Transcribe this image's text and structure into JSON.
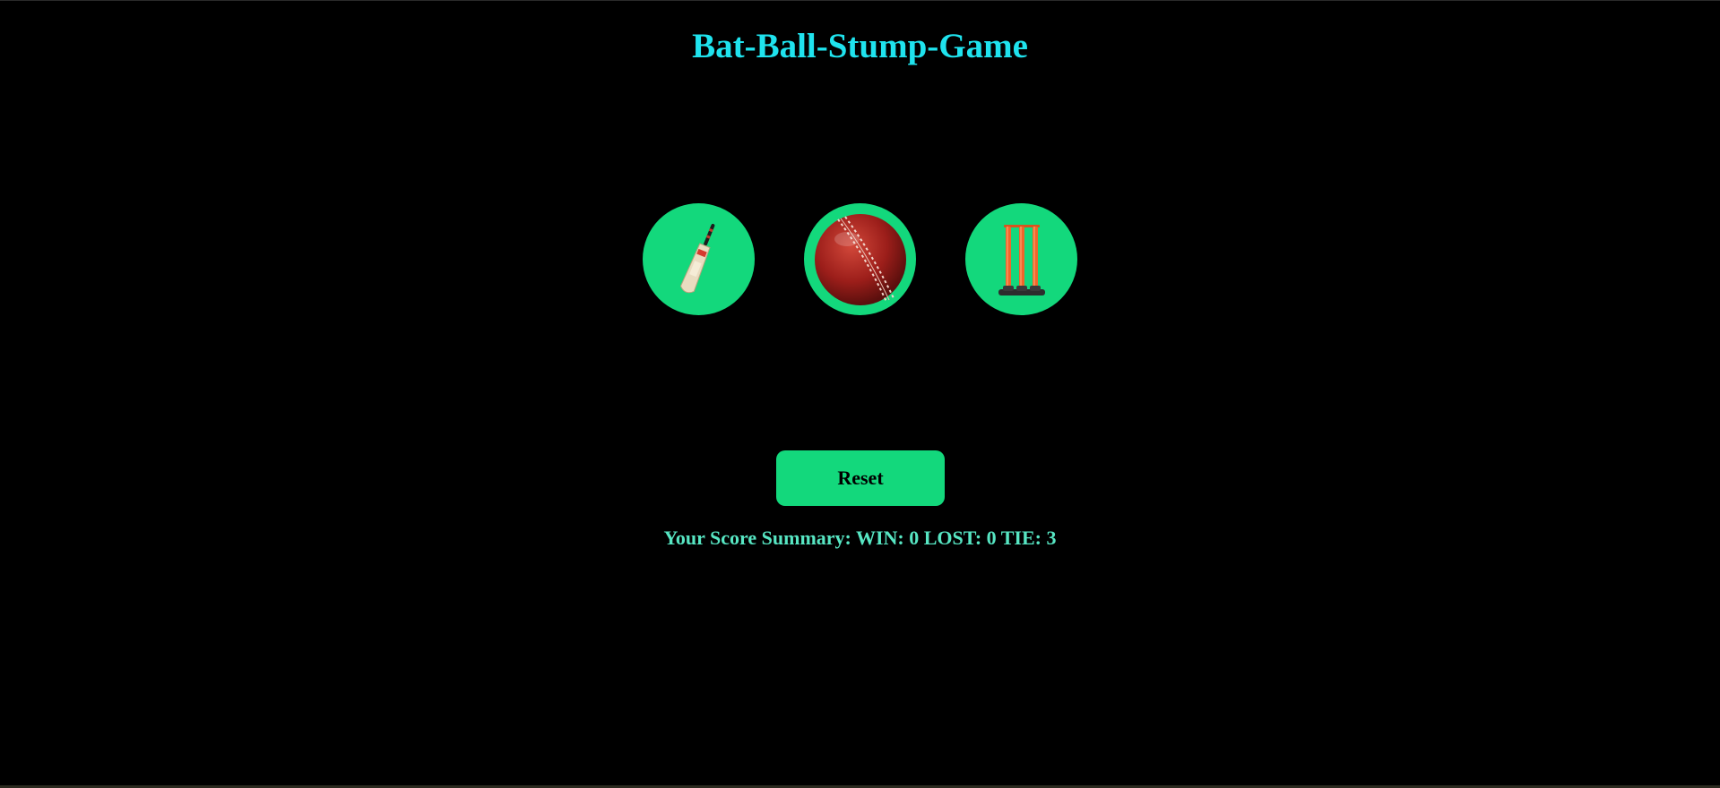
{
  "game": {
    "title": "Bat-Ball-Stump-Game",
    "choices": [
      {
        "name": "bat",
        "icon": "cricket-bat-icon"
      },
      {
        "name": "ball",
        "icon": "cricket-ball-icon"
      },
      {
        "name": "stump",
        "icon": "cricket-stumps-icon"
      }
    ],
    "reset_label": "Reset",
    "score_summary": "Your Score Summary: WIN: 0 LOST: 0 TIE: 3"
  },
  "colors": {
    "background": "#000000",
    "title": "#1fe3ee",
    "accent": "#13d87c",
    "score_text": "#57e6c3"
  }
}
